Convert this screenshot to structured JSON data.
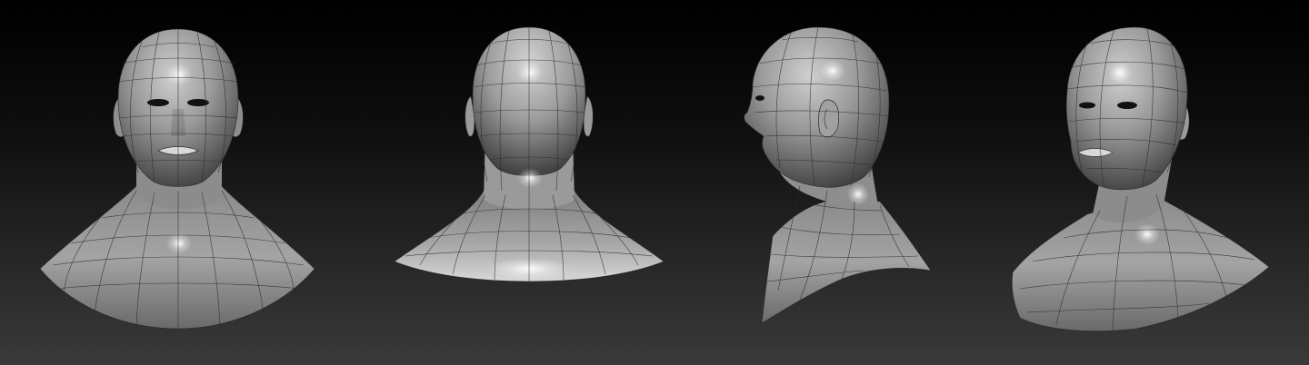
{
  "scene": {
    "background_top_color": "#000000",
    "background_bottom_color": "#3a3a3a",
    "mesh_base_color": "#9a9a9a",
    "mesh_highlight_color": "#f2f2f2",
    "wireframe_color": "#2a2a2a",
    "views": [
      {
        "name": "front"
      },
      {
        "name": "back"
      },
      {
        "name": "left-profile"
      },
      {
        "name": "three-quarter"
      }
    ]
  }
}
